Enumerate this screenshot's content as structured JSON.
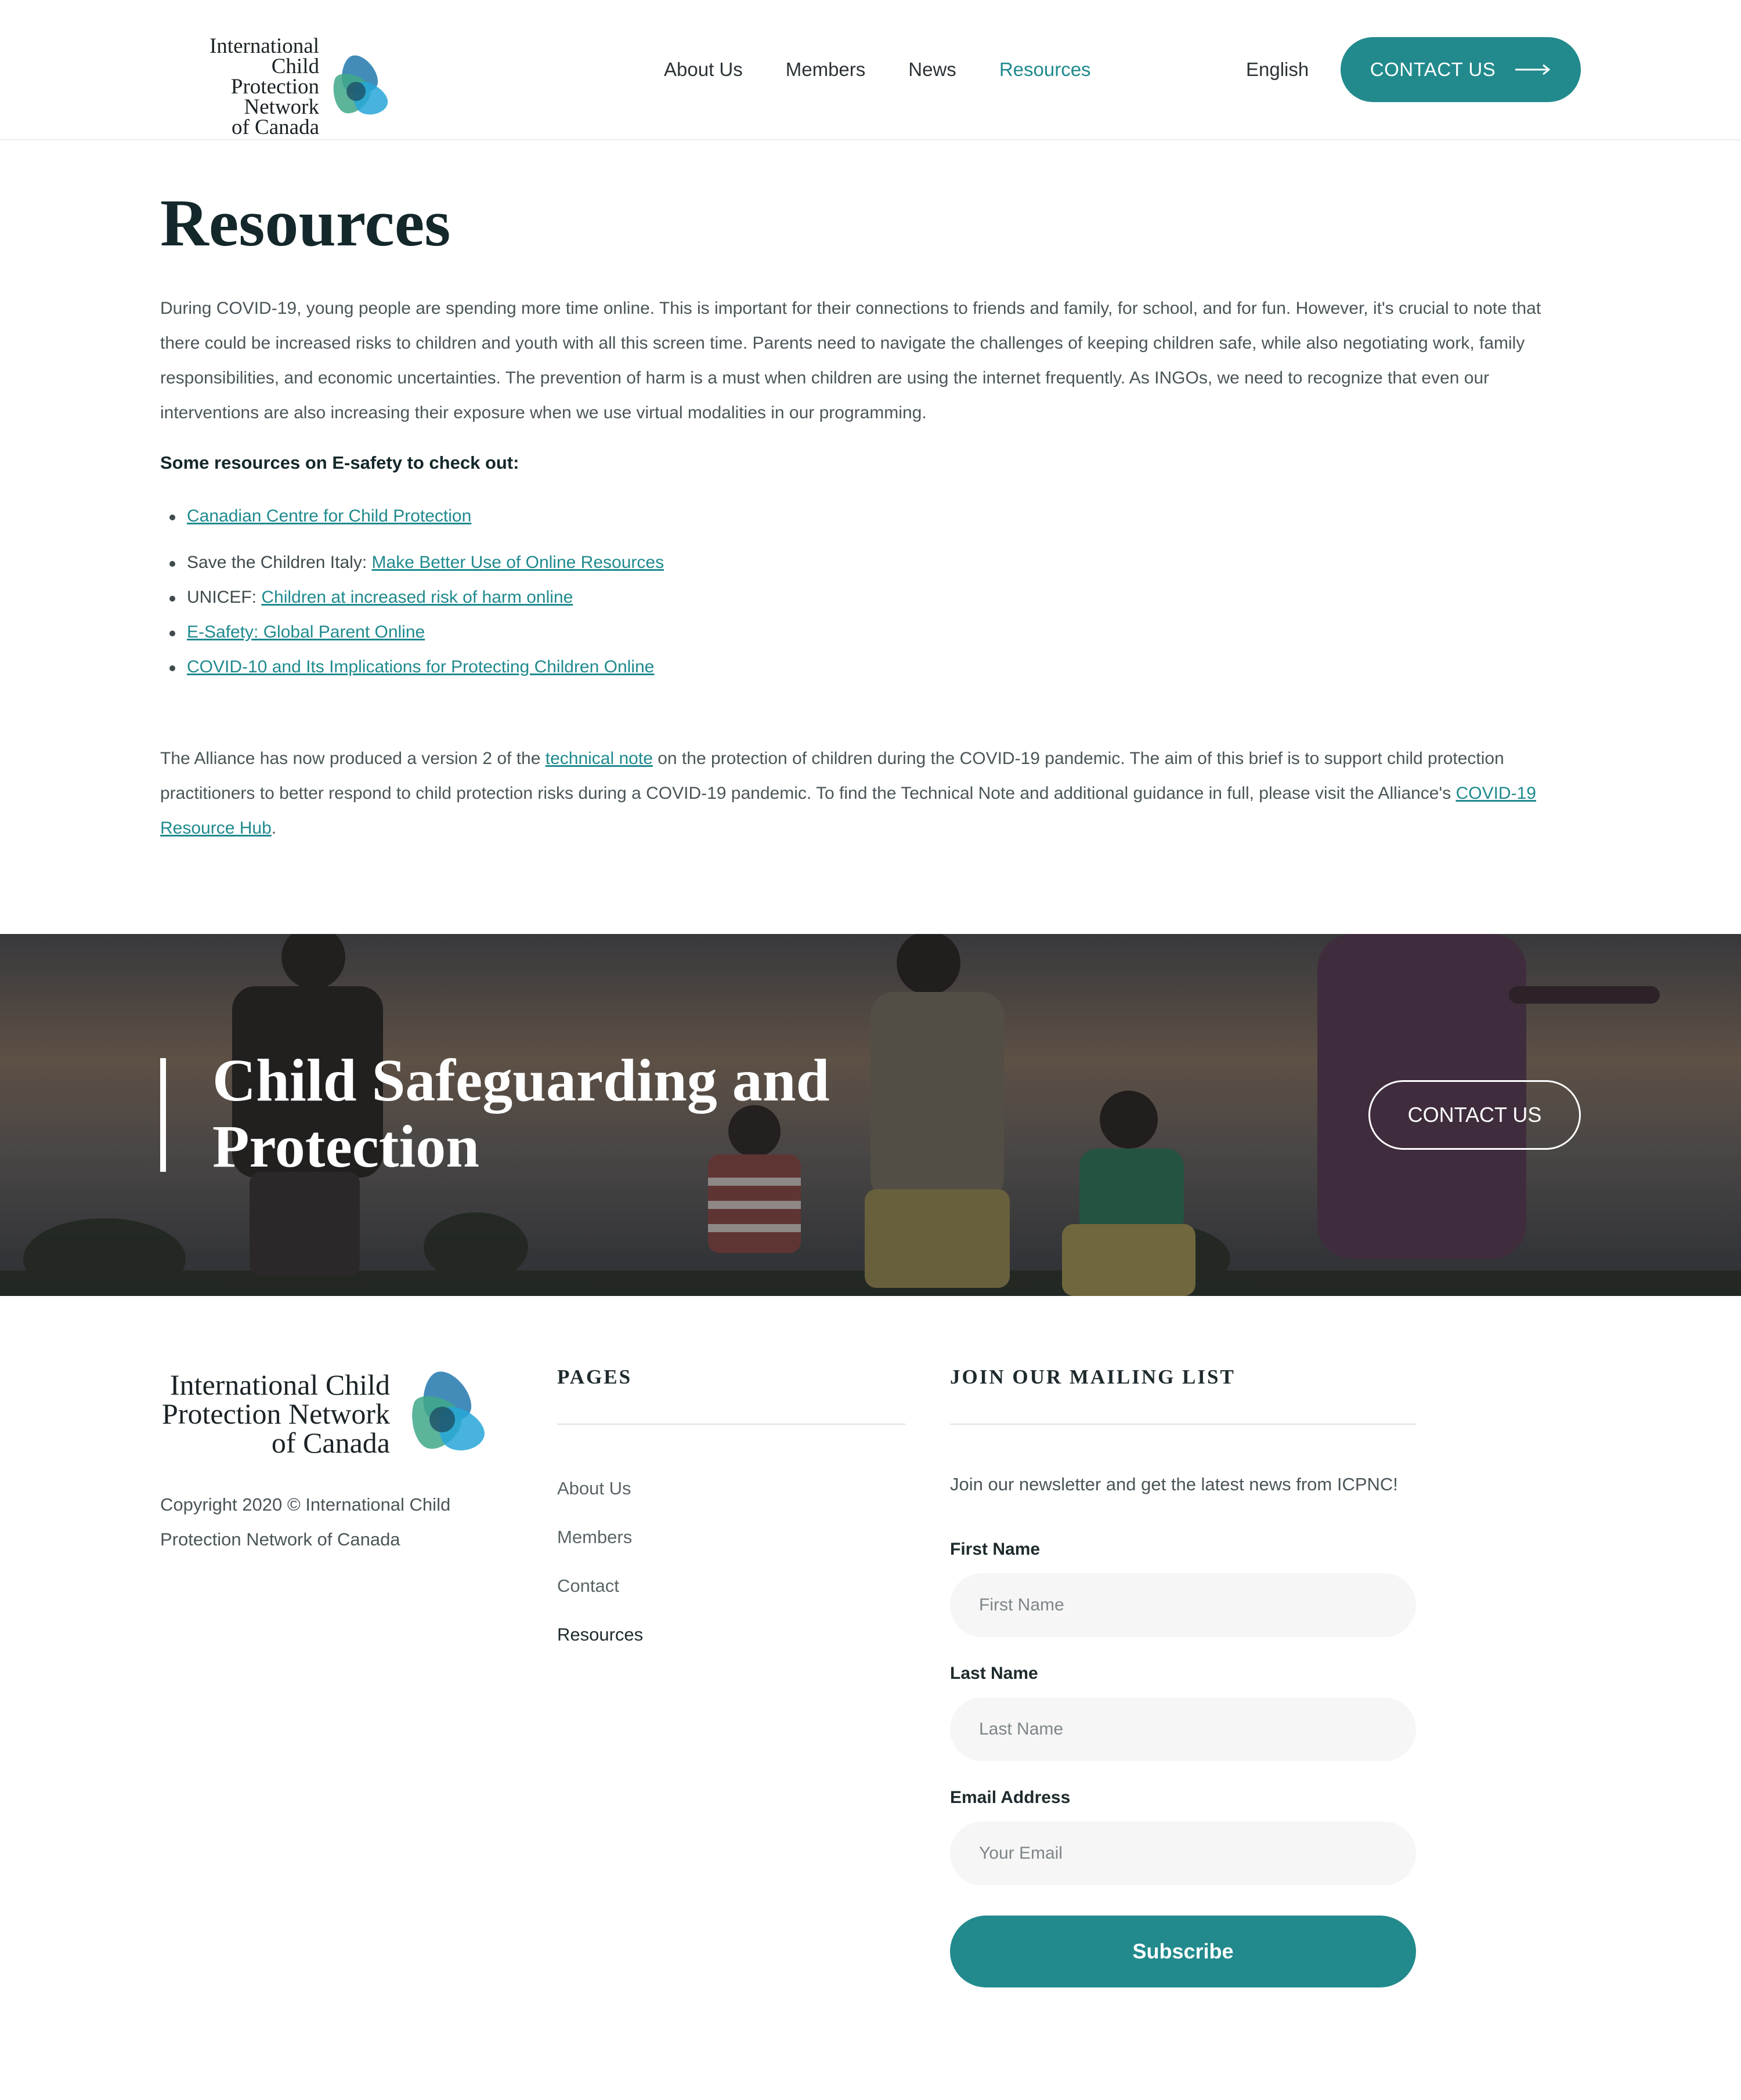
{
  "brand": {
    "name_line1": "International Child",
    "name_line2": "Protection Network",
    "name_line3": "of Canada",
    "colors": {
      "teal": "#228a8d",
      "teal_light": "#1f8a8e",
      "dark": "#14272a"
    },
    "logo_icon": "overlapping-triangles-logo"
  },
  "nav": {
    "items": [
      {
        "label": "About Us"
      },
      {
        "label": "Members"
      },
      {
        "label": "News"
      },
      {
        "label": "Resources",
        "active": true
      }
    ],
    "language": "English",
    "contact_label": "CONTACT US",
    "contact_icon": "arrow-right-icon"
  },
  "main": {
    "title": "Resources",
    "intro": "During COVID-19, young people are spending more time online. This is important for their connections to friends and family, for school, and for fun. However, it's crucial to note that there could be increased risks to children and youth with all this screen time. Parents need to navigate the challenges of keeping children safe, while also negotiating work, family responsibilities, and economic uncertainties. The prevention of harm is a must when children are using the internet frequently. As INGOs, we need to recognize that even our interventions are also increasing their exposure when we use virtual modalities in our programming.",
    "list_heading": "Some resources on E-safety to check out:",
    "resources": [
      {
        "prefix": "",
        "link": "Canadian Centre for Child Protection"
      },
      {
        "prefix": "Save the Children Italy: ",
        "link": "Make Better Use of Online Resources"
      },
      {
        "prefix": "UNICEF: ",
        "link": "Children at increased risk of harm online"
      },
      {
        "prefix": "",
        "link": "E-Safety: Global Parent Online"
      },
      {
        "prefix": "",
        "link": "COVID-10 and Its Implications for Protecting Children Online"
      }
    ],
    "alliance": {
      "part1": " The Alliance has now produced a version 2 of the ",
      "link1": "technical note",
      "part2": " on the protection of children during the COVID-19 pandemic. The aim of this brief is to support child protection practitioners to better respond to child protection risks during a COVID-19 pandemic. To find the Technical Note and additional guidance in full, please visit the Alliance's ",
      "link2": "COVID-19 Resource Hub",
      "part3": "."
    }
  },
  "banner": {
    "title_line1": "Child Safeguarding and",
    "title_line2": "Protection",
    "contact_label": "CONTACT US"
  },
  "footer": {
    "copyright": "Copyright 2020 © International Child Protection Network of Canada",
    "pages_title": "PAGES",
    "pages": [
      "About Us",
      "Members",
      "Contact",
      "Resources"
    ],
    "mailing_title": "JOIN OUR MAILING LIST",
    "mailing_intro": "Join our newsletter and get the latest news from ICPNC!",
    "first_name_label": "First Name",
    "first_name_placeholder": "First Name",
    "last_name_label": "Last Name",
    "last_name_placeholder": "Last Name",
    "email_label": "Email Address",
    "email_placeholder": "Your Email",
    "subscribe_label": "Subscribe"
  }
}
